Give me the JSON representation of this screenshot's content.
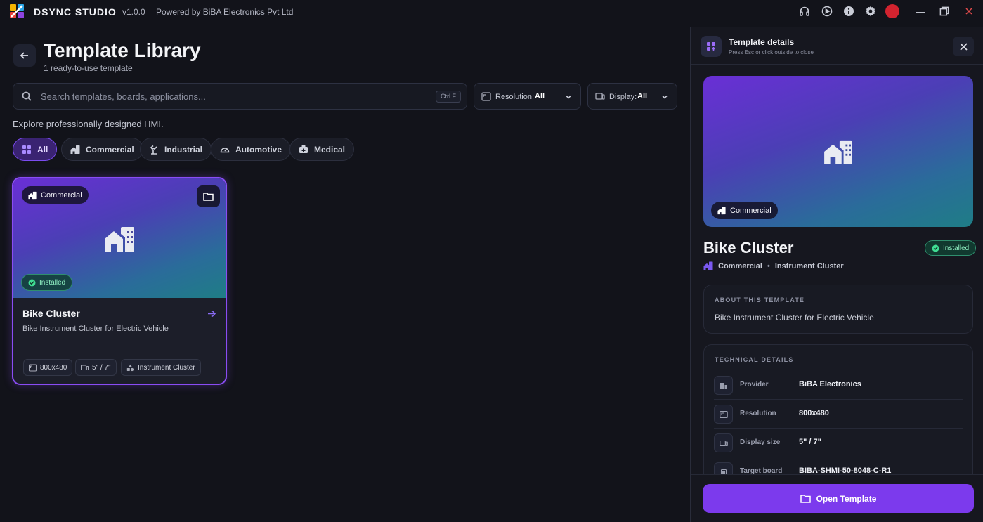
{
  "titlebar": {
    "app_name": "DSYNC STUDIO",
    "version": "v1.0.0",
    "powered_by": "Powered by BiBA Electronics Pvt Ltd"
  },
  "header": {
    "title": "Template Library",
    "subtitle": "1 ready-to-use template"
  },
  "search": {
    "placeholder": "Search templates, boards, applications...",
    "shortcut": "Ctrl F"
  },
  "filters": {
    "resolution_label": "Resolution:",
    "resolution_value": "All",
    "display_label": "Display:",
    "display_value": "All"
  },
  "explore_text": "Explore professionally designed HMI.",
  "categories": [
    {
      "label": "All",
      "active": true
    },
    {
      "label": "Commercial",
      "active": false
    },
    {
      "label": "Industrial",
      "active": false
    },
    {
      "label": "Automotive",
      "active": false
    },
    {
      "label": "Medical",
      "active": false
    }
  ],
  "card": {
    "category": "Commercial",
    "status": "Installed",
    "title": "Bike Cluster",
    "description": "Bike Instrument Cluster for Electric Vehicle",
    "specs": [
      "800x480",
      "5\" / 7\"",
      "Instrument Cluster"
    ]
  },
  "panel": {
    "header_title": "Template details",
    "header_sub": "Press Esc or click outside to close",
    "category": "Commercial",
    "title": "Bike Cluster",
    "status": "Installed",
    "meta_category": "Commercial",
    "meta_type": "Instrument Cluster",
    "about_label": "ABOUT THIS TEMPLATE",
    "about_text": "Bike Instrument Cluster for Electric Vehicle",
    "tech_label": "TECHNICAL DETAILS",
    "details": [
      {
        "label": "Provider",
        "value": "BiBA Electronics"
      },
      {
        "label": "Resolution",
        "value": "800x480"
      },
      {
        "label": "Display size",
        "value": "5\" / 7\""
      },
      {
        "label": "Target board",
        "value": "BIBA-SHMI-50-8048-C-R1"
      }
    ],
    "open_button": "Open Template"
  },
  "colors": {
    "accent": "#7c3aed",
    "background": "#12131a",
    "installed": "#3fdc93",
    "avatar": "#d2232f"
  }
}
